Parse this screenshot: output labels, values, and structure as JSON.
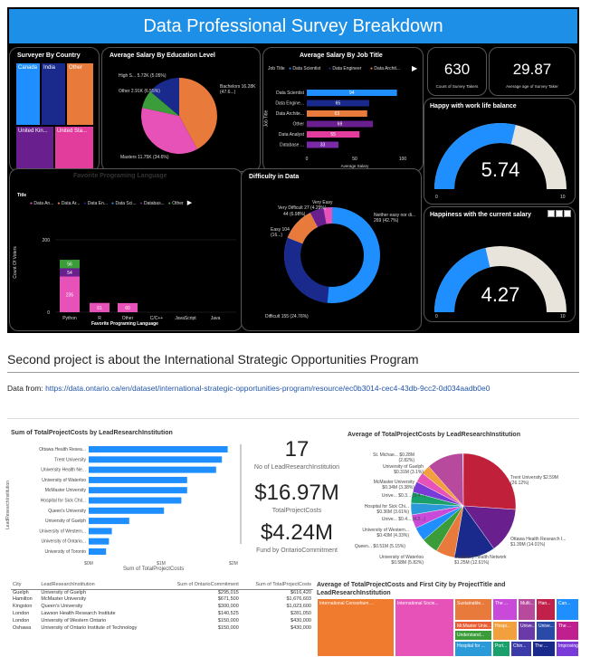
{
  "dashboard1": {
    "title": "Data Professional Survey Breakdown",
    "country": {
      "title": "Surveyer By Country",
      "cells": [
        {
          "label": "Canada",
          "color": "#1f8fff"
        },
        {
          "label": "India",
          "color": "#1a2a8c"
        },
        {
          "label": "Other",
          "color": "#e87a3c"
        },
        {
          "label": "United Kin...",
          "color": "#6a1f8e"
        },
        {
          "label": "United Sta...",
          "color": "#e23d9d"
        }
      ]
    },
    "education": {
      "title": "Average Salary By Education Level",
      "labels": [
        "High S... 5.72K (5.05%)",
        "Other 2.91K (6.55%)",
        "Bachelors 16.28K (47.6...)",
        "Masters 11.75K (34.6%)"
      ]
    },
    "job": {
      "title": "Average Salary By Job Title",
      "legend_title": "Job Title",
      "legend": [
        "Data Scientist",
        "Data Engineer",
        "Data Archit..."
      ],
      "rows": [
        {
          "label": "Data Scientist",
          "value": 94,
          "color": "#1f8fff"
        },
        {
          "label": "Data Engine...",
          "value": 65,
          "color": "#1a2a8c"
        },
        {
          "label": "Data Archite...",
          "value": 63,
          "color": "#e87a3c"
        },
        {
          "label": "Other",
          "value": 69,
          "color": "#6a1f8e"
        },
        {
          "label": "Data Analyst",
          "value": 55,
          "color": "#e23d9d"
        },
        {
          "label": "Database ...",
          "value": 33,
          "color": "#7a2aa8"
        }
      ],
      "ticks": [
        "0",
        "50",
        "100"
      ],
      "xlabel": "Average Salary",
      "ylabel": "Job Title"
    },
    "kpi1": {
      "value": "630",
      "label": "Count of Survey Takers"
    },
    "kpi2": {
      "value": "29.87",
      "label": "Average age of Survey Taker"
    },
    "gauge1": {
      "title": "Happy with work life balance",
      "value": "5.74",
      "min": "0",
      "max": "10",
      "fraction": 0.574
    },
    "gauge2": {
      "title": "Happiness with the current salary",
      "value": "4.27",
      "min": "0",
      "max": "10",
      "fraction": 0.427
    },
    "language": {
      "title": "Favorite Programing Language",
      "legend_title": "Title",
      "legend": [
        "Data An...",
        "Data Ar...",
        "Data En...",
        "Data Sci...",
        "Databas...",
        "Other"
      ],
      "categories": [
        "Python",
        "R",
        "Other",
        "C/C++",
        "JavaScript",
        "Java"
      ],
      "stack_values": {
        "python": [
          235,
          54,
          56
        ],
        "r": [
          61
        ],
        "other": [
          60
        ]
      },
      "labels": [
        "235",
        "54",
        "56",
        "61",
        "60"
      ],
      "yticks": [
        "400",
        "200",
        "0"
      ],
      "xlabel": "Favorite Programing Language",
      "ylabel": "Count Of Voters"
    },
    "difficulty": {
      "title": "Difficulty in Data",
      "labels": [
        "Very Easy",
        "Very Difficult 27 (4.29%)",
        "44 (6.98%)",
        "Easy 104 (16...)",
        "Neither easy nor di... 269 (42.7%)",
        "Difficult 155 (24.76%)"
      ]
    }
  },
  "section": {
    "heading": "Second project is about the International Strategic Opportunities Program",
    "data_from": "Data from:",
    "link": "https://data.ontario.ca/en/dataset/international-strategic-opportunities-program/resource/ec0b3014-cec4-43db-9cc2-0d034aadb0e0"
  },
  "dashboard2": {
    "bar_title": "Sum of TotalProjectCosts by LeadResearchInstitution",
    "bar_xlabel": "Sum of TotalProjectCosts",
    "bar_ylabel": "LeadResearchInstitution",
    "bar_ticks": [
      "$0M",
      "$1M",
      "$2M"
    ],
    "bars": [
      {
        "label": "Ottawa Health Resea...",
        "value": 2.4
      },
      {
        "label": "Trent University",
        "value": 2.3
      },
      {
        "label": "University Health Ne...",
        "value": 2.2
      },
      {
        "label": "University of Waterloo",
        "value": 1.7
      },
      {
        "label": "McMaster University",
        "value": 1.7
      },
      {
        "label": "Hospital for Sick Chil...",
        "value": 1.6
      },
      {
        "label": "Queen's University",
        "value": 1.3
      },
      {
        "label": "University of Guelph",
        "value": 0.7
      },
      {
        "label": "University of Western...",
        "value": 0.4
      },
      {
        "label": "University of Ontario...",
        "value": 0.35
      },
      {
        "label": "University of Toronto",
        "value": 0.3
      }
    ],
    "kpi_count": {
      "value": "17",
      "label": "No of LeadResearchInstitution"
    },
    "kpi_total": {
      "value": "$16.97M",
      "label": "TotalProjectCosts"
    },
    "kpi_fund": {
      "value": "$4.24M",
      "label": "Fund by OntarioCommitment"
    },
    "pie_title": "Average of TotalProjectCosts by LeadResearchInstitution",
    "pie_labels": [
      "St. Michae... $0.28M (2.82%)",
      "University of Guelph $0.31M (3.1%)",
      "McMaster University $0.34M (3.38%)",
      "Unive... $0.3... (3.4...)",
      "Hospital for Sick Chi... $0.36M (3.61%)",
      "Unive... $0.4... (4.2...)",
      "University of Western... $0.43M (4.33%)",
      "Queen... $0.51M (5.15%)",
      "University of Waterloo $0.58M (5.82%)",
      "Trent University $2.59M (26.12%)",
      "Ottawa Health Research I... $1.39M (14.01%)",
      "University Health Network $1.25M (12.61%)"
    ],
    "table": {
      "headers": [
        "City",
        "LeadResearchInstitution",
        "Sum of OntarioCommitment",
        "Sum of TotalProjectCosts"
      ],
      "rows": [
        [
          "Guelph",
          "University of Guelph",
          "$295,015",
          "$616,420"
        ],
        [
          "Hamilton",
          "McMaster University",
          "$671,500",
          "$1,676,603"
        ],
        [
          "Kingston",
          "Queen's University",
          "$300,000",
          "$1,023,600"
        ],
        [
          "London",
          "Lawson Health Research Institute",
          "$140,525",
          "$281,050"
        ],
        [
          "London",
          "University of Western Ontario",
          "$150,000",
          "$430,000"
        ],
        [
          "Oshawa",
          "University of Ontario Institute of Technology",
          "$150,000",
          "$430,000"
        ]
      ]
    },
    "treemap_title": "Average of TotalProjectCosts and First City by ProjectTitle and LeadResearchInstitution",
    "treemap": [
      {
        "label": "International Consortium ...",
        "color": "#f07b2f"
      },
      {
        "label": "International Socie...",
        "color": "#e752b9"
      },
      {
        "label": "Sustainable...",
        "color": "#e87a3c"
      },
      {
        "label": "The ...",
        "color": "#c94ad8"
      },
      {
        "label": "Multi...",
        "color": "#b84a9e"
      },
      {
        "label": "Han...",
        "color": "#c0204a"
      },
      {
        "label": "Can...",
        "color": "#1f8fff"
      },
      {
        "label": "McMaster Univ...",
        "color": "#e85d33"
      },
      {
        "label": "Understand...",
        "color": "#3a9d3a"
      },
      {
        "label": "Hospi...",
        "color": "#f29f3e"
      },
      {
        "label": "Unive...",
        "color": "#6a3aa8"
      },
      {
        "label": "Unive...",
        "color": "#2a4aa8"
      },
      {
        "label": "Hospital for ...",
        "color": "#2a9ad8"
      },
      {
        "label": "Port...",
        "color": "#1aa06a"
      },
      {
        "label": "Chin...",
        "color": "#3a3aa8"
      },
      {
        "label": "The ...",
        "color": "#1a2a8c"
      },
      {
        "label": "The ...",
        "color": "#c01f8f"
      },
      {
        "label": "Improving ...",
        "color": "#7a3ad8"
      }
    ]
  }
}
